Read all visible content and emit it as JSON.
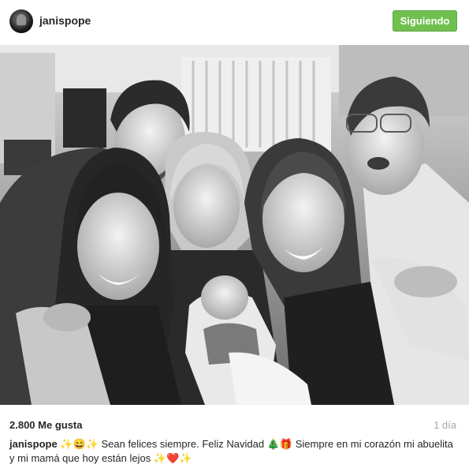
{
  "header": {
    "username": "janispope",
    "follow_label": "Siguiendo",
    "follow_color": "#70c050"
  },
  "photo": {
    "style": "black-and-white",
    "description_icon": "family-photo"
  },
  "footer": {
    "likes": "2.800 Me gusta",
    "time": "1 día",
    "caption_user": "janispope",
    "caption_text": " ✨😄✨ Sean felices siempre. Feliz Navidad 🎄🎁 Siempre en mi corazón mi abuelita y mi mamá que hoy están lejos ✨❤️✨"
  }
}
